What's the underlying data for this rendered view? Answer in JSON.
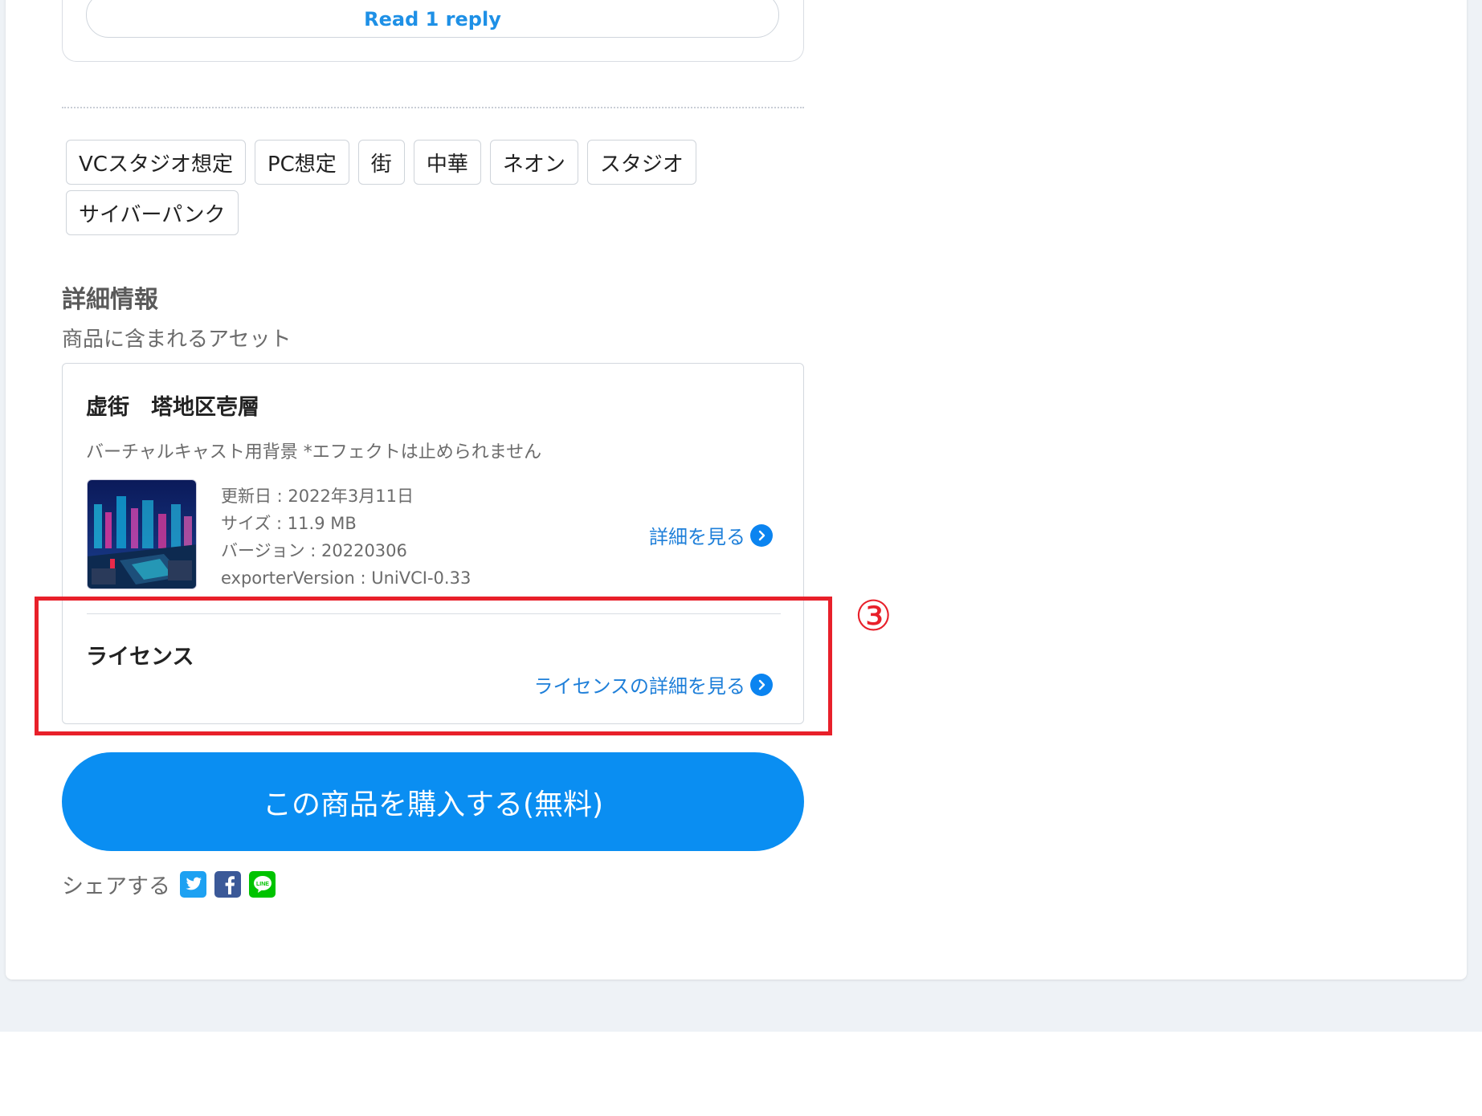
{
  "comments": {
    "reply_button_label": "Read 1 reply"
  },
  "tags": [
    "VCスタジオ想定",
    "PC想定",
    "街",
    "中華",
    "ネオン",
    "スタジオ",
    "サイバーパンク"
  ],
  "details": {
    "heading": "詳細情報",
    "subheading": "商品に含まれるアセット",
    "asset": {
      "title": "虚街　塔地区壱層",
      "description": "バーチャルキャスト用背景 *エフェクトは止められません",
      "meta": [
        "更新日 : 2022年3月11日",
        "サイズ : 11.9 MB",
        "バージョン : 20220306",
        "exporterVersion : UniVCI-0.33"
      ],
      "detail_link": "詳細を見る"
    },
    "license": {
      "title": "ライセンス",
      "link": "ライセンスの詳細を見る"
    }
  },
  "annotation": {
    "step_number": "③",
    "color": "#e8202a"
  },
  "purchase": {
    "button_label": "この商品を購入する(無料)",
    "color": "#0a8ef2"
  },
  "share": {
    "label": "シェアする",
    "icons": [
      "twitter-icon",
      "facebook-icon",
      "line-icon"
    ]
  }
}
